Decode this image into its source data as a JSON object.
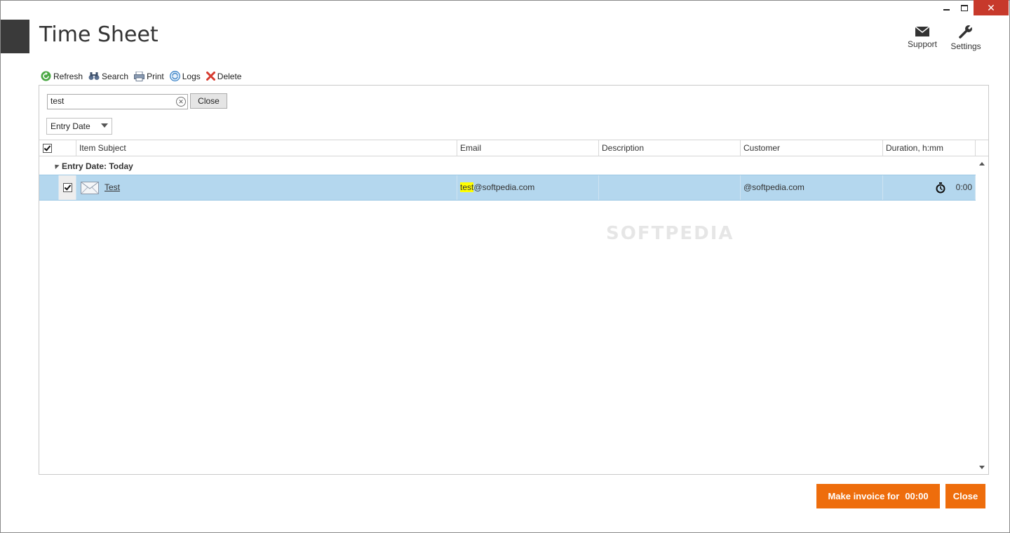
{
  "window": {
    "title": "Time Sheet",
    "controls": {
      "minimize": "minimize",
      "maximize": "maximize",
      "close": "close"
    }
  },
  "top_actions": [
    {
      "label": "Support",
      "icon": "envelope-icon"
    },
    {
      "label": "Settings",
      "icon": "wrench-icon"
    }
  ],
  "toolbar": {
    "refresh_label": "Refresh",
    "search_label": "Search",
    "print_label": "Print",
    "logs_label": "Logs",
    "delete_label": "Delete"
  },
  "search": {
    "value": "test",
    "clear_icon": "clear-icon",
    "close_label": "Close"
  },
  "group_by": {
    "selected": "Entry Date"
  },
  "grid": {
    "header_checked": true,
    "columns": [
      "Item Subject",
      "Email",
      "Description",
      "Customer",
      "Duration, h:mm"
    ],
    "group_label": "Entry Date: Today",
    "rows": [
      {
        "checked": true,
        "subject": "Test",
        "email_highlight": "test",
        "email_rest": "@softpedia.com",
        "description": "",
        "customer": "@softpedia.com",
        "duration": "0:00"
      }
    ]
  },
  "footer": {
    "invoice_label": "Make invoice for",
    "invoice_amount": "00:00",
    "close_label": "Close"
  },
  "watermark": "SOFTPEDIA",
  "colors": {
    "accent_orange": "#ee6d0c",
    "selected_row": "#b4d7ee",
    "highlight": "#ffff00",
    "close_button": "#c7392b"
  }
}
